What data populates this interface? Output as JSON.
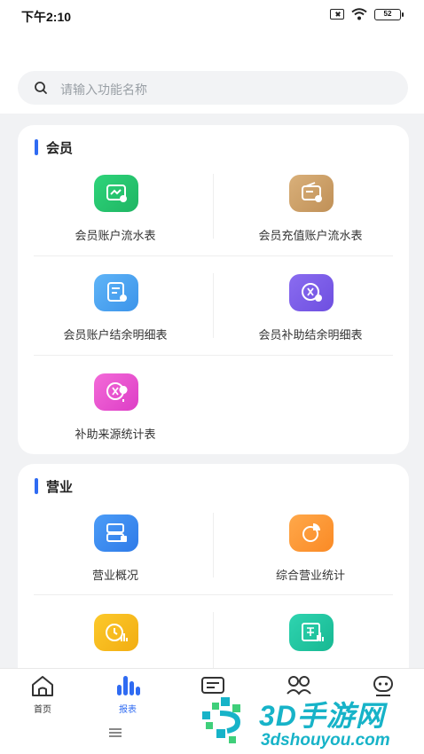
{
  "status_bar": {
    "time": "下午2:10",
    "battery": "52"
  },
  "search": {
    "placeholder": "请输入功能名称"
  },
  "sections": [
    {
      "title": "会员",
      "items": [
        {
          "label": "会员账户流水表",
          "icon": "account-flow-icon",
          "color": "#22c46c"
        },
        {
          "label": "会员充值账户流水表",
          "icon": "recharge-wallet-icon",
          "color": "#cc9f68"
        },
        {
          "label": "会员账户结余明细表",
          "icon": "balance-document-icon",
          "color": "#4ba4f1"
        },
        {
          "label": "会员补助结余明细表",
          "icon": "subsidy-balance-icon",
          "color": "#7b5de8"
        },
        {
          "label": "补助来源统计表",
          "icon": "subsidy-source-icon",
          "color": "#e852cf"
        }
      ]
    },
    {
      "title": "营业",
      "items": [
        {
          "label": "营业概况",
          "icon": "business-overview-icon",
          "color": "#3d8cf0"
        },
        {
          "label": "综合营业统计",
          "icon": "pie-chart-icon",
          "color": "#fc9a35"
        },
        {
          "label": "",
          "icon": "clock-chart-icon",
          "color": "#f7bb1d"
        },
        {
          "label": "",
          "icon": "bar-report-icon",
          "color": "#23c6a1"
        }
      ]
    }
  ],
  "tabbar": {
    "items": [
      {
        "label": "首页",
        "icon": "home-icon"
      },
      {
        "label": "报表",
        "icon": "report-bars-icon",
        "active": true
      },
      {
        "label": "",
        "icon": "message-icon"
      },
      {
        "label": "",
        "icon": "contacts-icon"
      },
      {
        "label": "",
        "icon": "profile-icon"
      }
    ]
  },
  "watermark": {
    "title": "3D手游网",
    "url": "3dshouyou.com"
  },
  "colors": {
    "accent": "#2f6bf2",
    "watermark": "#17b3c8"
  }
}
